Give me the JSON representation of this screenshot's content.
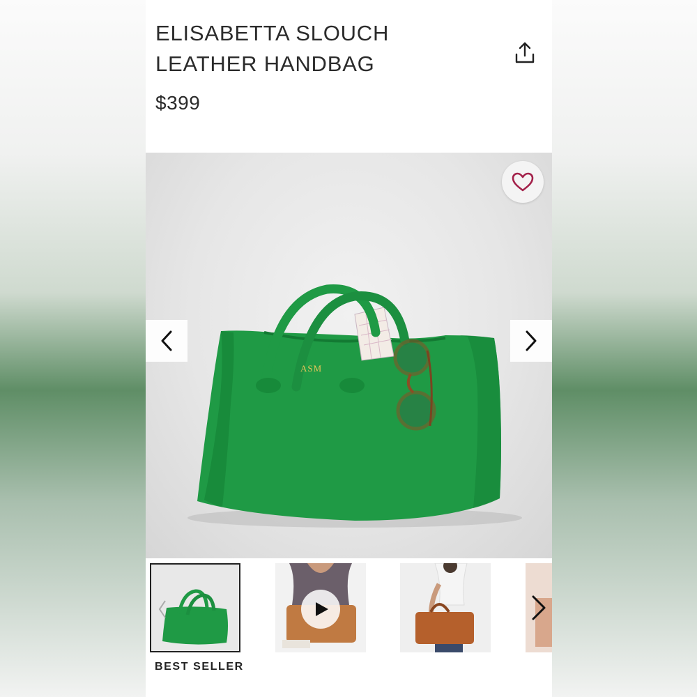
{
  "product": {
    "title": "ELISABETTA SLOUCH LEATHER HANDBAG",
    "price": "$399",
    "monogram": "ASM",
    "badge": "BEST SELLER"
  },
  "icons": {
    "share": "share-icon",
    "favorite": "heart-icon",
    "prev": "chevron-left-icon",
    "next": "chevron-right-icon",
    "play": "play-icon"
  },
  "colors": {
    "bag_green": "#1f9a45",
    "heart": "#a3214a",
    "text": "#2b2b2b"
  }
}
